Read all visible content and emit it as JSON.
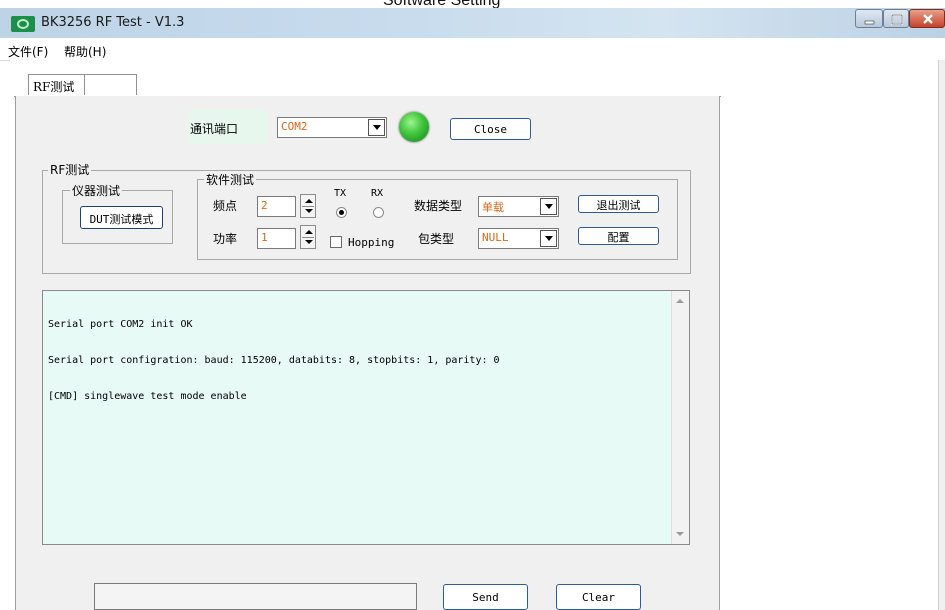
{
  "caption": "Software Setting",
  "window": {
    "title": "BK3256 RF Test - V1.3"
  },
  "menu": {
    "file": "文件(F)",
    "help": "帮助(H)"
  },
  "tabs": [
    "RF测试",
    ""
  ],
  "comm": {
    "label": "通讯端口",
    "port": "COM2",
    "close_label": "Close"
  },
  "rf_group": {
    "title": "RF测试",
    "instrument": {
      "title": "仪器测试",
      "dut_button": "DUT测试模式"
    },
    "software": {
      "title": "软件测试",
      "freq_label": "频点",
      "freq_value": "2",
      "power_label": "功率",
      "power_value": "1",
      "tx_label": "TX",
      "rx_label": "RX",
      "tx_selected": true,
      "hopping_label": "Hopping",
      "hopping_checked": false,
      "data_type_label": "数据类型",
      "data_type_value": "单载",
      "packet_type_label": "包类型",
      "packet_type_value": "NULL",
      "exit_button": "退出测试",
      "config_button": "配置"
    }
  },
  "log": {
    "lines": [
      "Serial port COM2 init OK",
      "Serial port configration: baud: 115200, databits: 8, stopbits: 1, parity: 0",
      "[CMD] singlewave test mode enable"
    ]
  },
  "bottom": {
    "send_value": "",
    "send_label": "Send",
    "clear_label": "Clear"
  },
  "colors": {
    "log_background": "#e8faf6",
    "field_text": "#d2691e",
    "status_led": "#3ec43a"
  }
}
